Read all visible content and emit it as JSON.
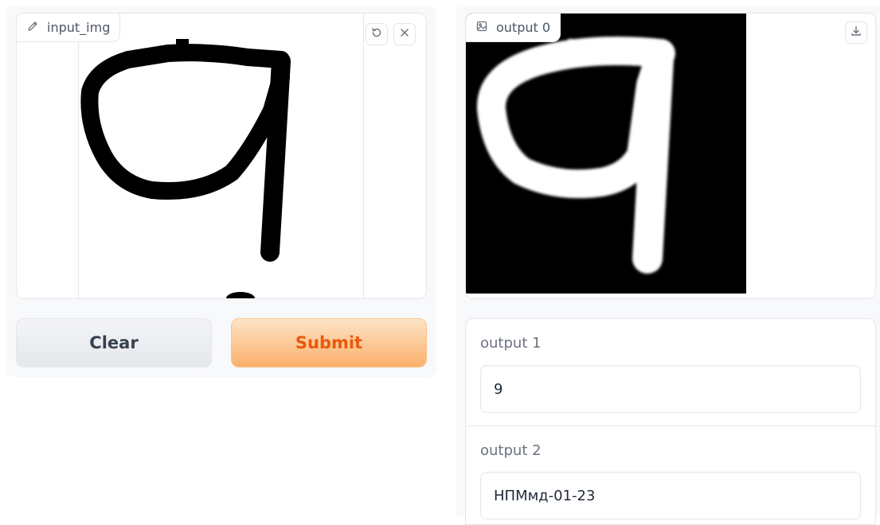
{
  "input_panel": {
    "label": "input_img",
    "icons": {
      "label_icon": "pencil-icon",
      "undo": "undo-icon",
      "clear": "close-icon"
    }
  },
  "buttons": {
    "clear_label": "Clear",
    "submit_label": "Submit"
  },
  "output_image": {
    "label": "output 0",
    "icons": {
      "label_icon": "image-icon",
      "download": "download-icon"
    }
  },
  "output_1": {
    "label": "output 1",
    "value": "9"
  },
  "output_2": {
    "label": "output 2",
    "value": "НПМмд-01-23"
  },
  "colors": {
    "submit_text": "#ea580c",
    "submit_bg_top": "#fde4c6",
    "submit_bg_bottom": "#fbb06b",
    "panel_border": "#e4e6ea",
    "page_bg": "#f8f9fb"
  }
}
